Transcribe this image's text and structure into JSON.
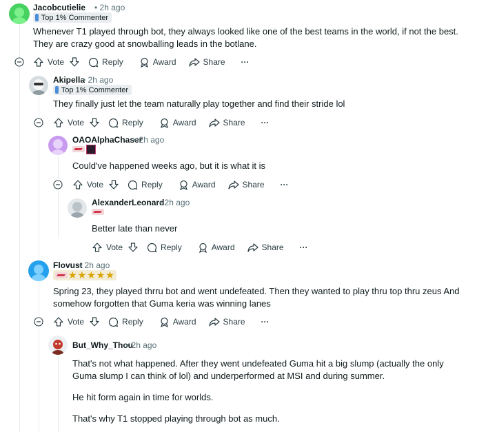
{
  "actions": {
    "vote": "Vote",
    "reply": "Reply",
    "award": "Award",
    "share": "Share",
    "more": "···"
  },
  "comments": [
    {
      "username": "Jacobcutielie",
      "time": "• 2h ago",
      "flair": "Top 1% Commenter",
      "lines": [
        "Whenever T1 played through bot, they always looked like one of the best teams in the world, if not the best.",
        "They are crazy good at snowballing leads in the botlane."
      ]
    },
    {
      "username": "Akipella",
      "time": "• 2h ago",
      "flair": "Top 1% Commenter",
      "lines": [
        "They finally just let the team naturally play together and find their stride lol"
      ]
    },
    {
      "username": "OAOAlphaChaser",
      "time": "• 2h ago",
      "lines": [
        "Could've happened weeks ago, but it is what it is"
      ]
    },
    {
      "username": "AlexanderLeonard",
      "time": "• 2h ago",
      "lines": [
        "Better late than never"
      ]
    },
    {
      "username": "Flovust",
      "time": "• 2h ago",
      "lines": [
        "Spring 23, they played thrru bot and went undefeated. Then they wanted to play thru top thru zeus And",
        "somehow forgotten that Guma keria was winning lanes"
      ]
    },
    {
      "username": "But_Why_Thou",
      "time": "• 2h ago",
      "paragraphs": [
        [
          "That's not what happened. After they went undefeated Guma hit a big slump (actually the only",
          "Guma slump I can think of lol) and underperformed at MSI and during summer."
        ],
        [
          "He hit form again in time for worlds."
        ],
        [
          "That's why T1 stopped playing through bot as much."
        ]
      ]
    }
  ],
  "colors": {
    "accent": "#0079d3",
    "text": "#0f1a1c",
    "meta": "#576f76",
    "thread": "#e5ebee"
  }
}
